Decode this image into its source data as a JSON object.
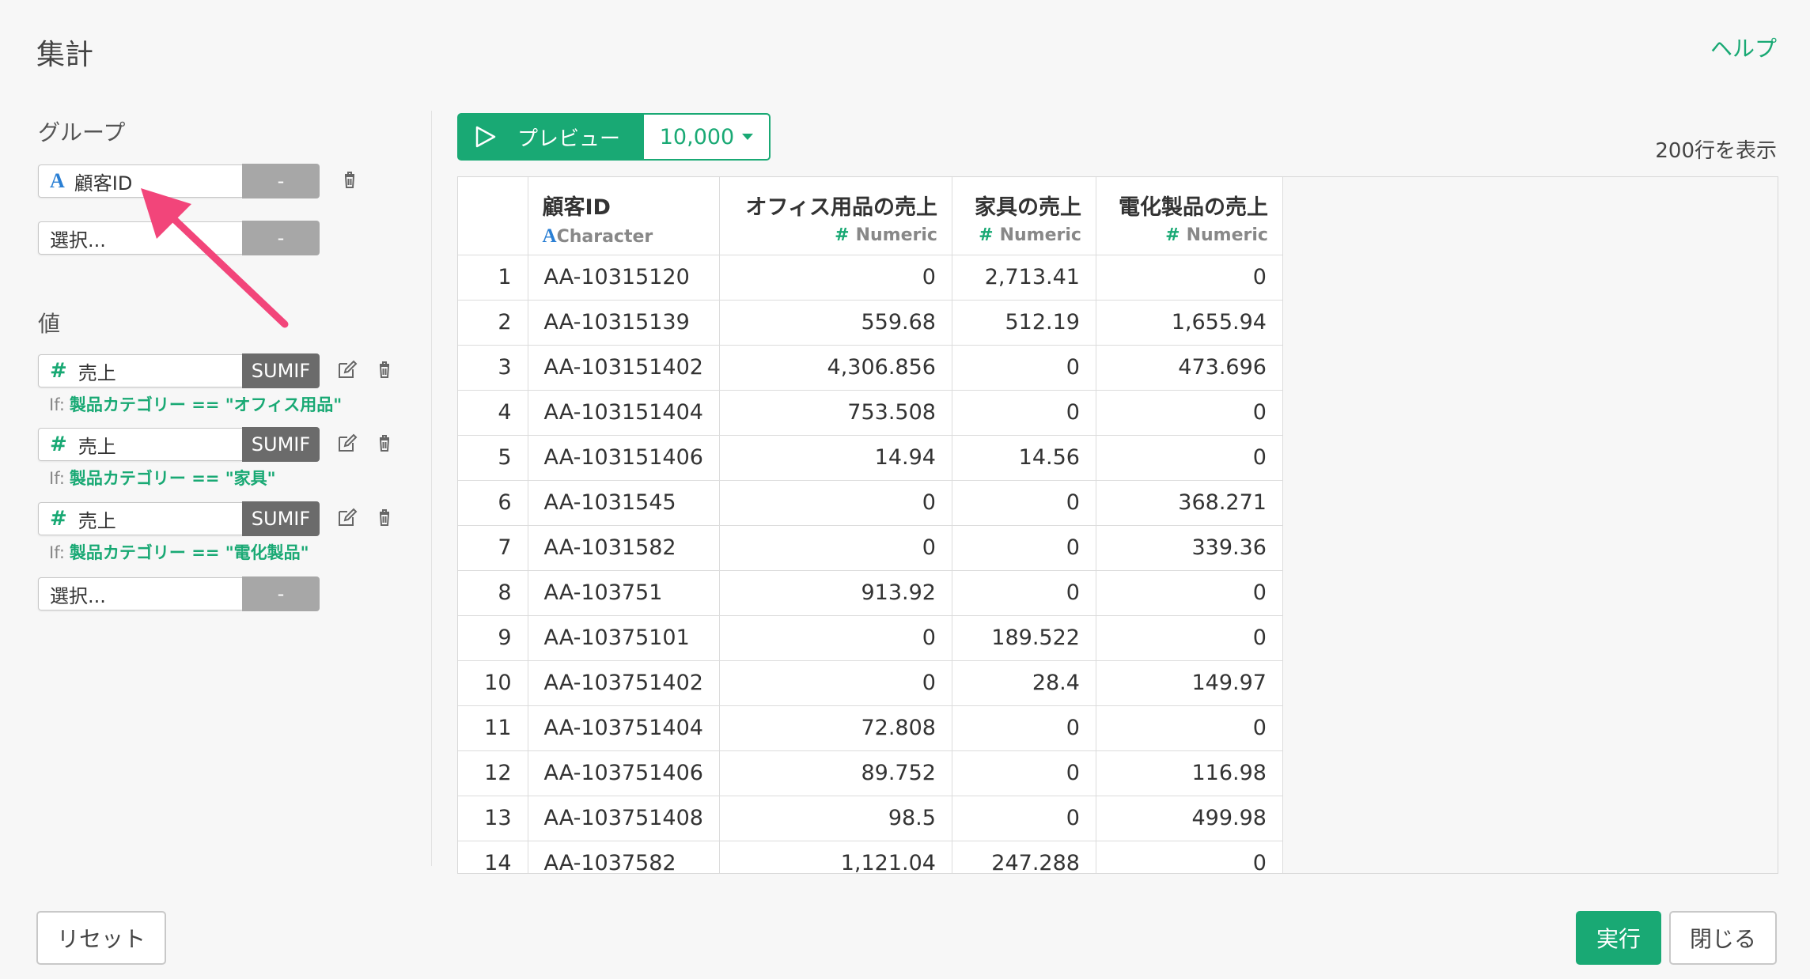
{
  "header": {
    "title": "集計",
    "help": "ヘルプ"
  },
  "group": {
    "label": "グループ",
    "items": [
      {
        "type_icon": "A",
        "value": "顧客ID",
        "button": "-"
      }
    ],
    "select": {
      "placeholder": "選択...",
      "button": "-"
    }
  },
  "values": {
    "label": "値",
    "items": [
      {
        "type_icon": "#",
        "value": "売上",
        "func": "SUMIF",
        "if_label": "If:",
        "condition": "製品カテゴリー == \"オフィス用品\""
      },
      {
        "type_icon": "#",
        "value": "売上",
        "func": "SUMIF",
        "if_label": "If:",
        "condition": "製品カテゴリー == \"家具\""
      },
      {
        "type_icon": "#",
        "value": "売上",
        "func": "SUMIF",
        "if_label": "If:",
        "condition": "製品カテゴリー == \"電化製品\""
      }
    ],
    "select": {
      "placeholder": "選択...",
      "button": "-"
    }
  },
  "preview": {
    "label": "プレビュー",
    "limit": "10,000",
    "row_count": "200行を表示"
  },
  "table": {
    "columns": [
      {
        "name": "顧客ID",
        "type_icon": "A",
        "type": "Character"
      },
      {
        "name": "オフィス用品の売上",
        "type_icon": "#",
        "type": "Numeric"
      },
      {
        "name": "家具の売上",
        "type_icon": "#",
        "type": "Numeric"
      },
      {
        "name": "電化製品の売上",
        "type_icon": "#",
        "type": "Numeric"
      }
    ],
    "rows": [
      [
        "1",
        "AA-10315120",
        "0",
        "2,713.41",
        "0"
      ],
      [
        "2",
        "AA-10315139",
        "559.68",
        "512.19",
        "1,655.94"
      ],
      [
        "3",
        "AA-103151402",
        "4,306.856",
        "0",
        "473.696"
      ],
      [
        "4",
        "AA-103151404",
        "753.508",
        "0",
        "0"
      ],
      [
        "5",
        "AA-103151406",
        "14.94",
        "14.56",
        "0"
      ],
      [
        "6",
        "AA-1031545",
        "0",
        "0",
        "368.271"
      ],
      [
        "7",
        "AA-1031582",
        "0",
        "0",
        "339.36"
      ],
      [
        "8",
        "AA-103751",
        "913.92",
        "0",
        "0"
      ],
      [
        "9",
        "AA-10375101",
        "0",
        "189.522",
        "0"
      ],
      [
        "10",
        "AA-103751402",
        "0",
        "28.4",
        "149.97"
      ],
      [
        "11",
        "AA-103751404",
        "72.808",
        "0",
        "0"
      ],
      [
        "12",
        "AA-103751406",
        "89.752",
        "0",
        "116.98"
      ],
      [
        "13",
        "AA-103751408",
        "98.5",
        "0",
        "499.98"
      ],
      [
        "14",
        "AA-1037582",
        "1,121.04",
        "247.288",
        "0"
      ]
    ]
  },
  "footer": {
    "reset": "リセット",
    "run": "実行",
    "close": "閉じる"
  },
  "colors": {
    "accent": "#19a974",
    "character_type": "#2a7fd4",
    "annotation_arrow": "#f2457a"
  }
}
